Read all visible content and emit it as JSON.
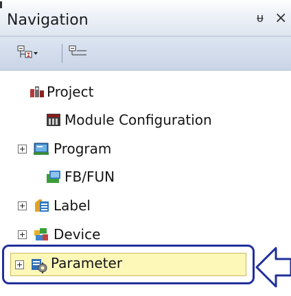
{
  "panel": {
    "title": "Navigation",
    "pin_glyph": "ᵾ",
    "close_glyph": "×"
  },
  "toolbar": {
    "buttons": [
      {
        "icon": "expand-collapse-dropdown-icon"
      },
      {
        "icon": "collapse-tree-icon"
      }
    ]
  },
  "tree": {
    "items": [
      {
        "label": "Project",
        "icon": "project-icon",
        "expandable": false
      },
      {
        "label": "Module Configuration",
        "icon": "module-configuration-icon",
        "expandable": false
      },
      {
        "label": "Program",
        "icon": "program-icon",
        "expandable": true
      },
      {
        "label": "FB/FUN",
        "icon": "fb-fun-icon",
        "expandable": false
      },
      {
        "label": "Label",
        "icon": "label-icon",
        "expandable": true
      },
      {
        "label": "Device",
        "icon": "device-icon",
        "expandable": true
      },
      {
        "label": "Parameter",
        "icon": "parameter-icon",
        "expandable": true,
        "highlighted": true
      }
    ]
  },
  "colors": {
    "highlight_border": "#1f2f9a",
    "highlight_fill": "#fdf7b8",
    "toolbar_bg": "#c9d4e6"
  }
}
